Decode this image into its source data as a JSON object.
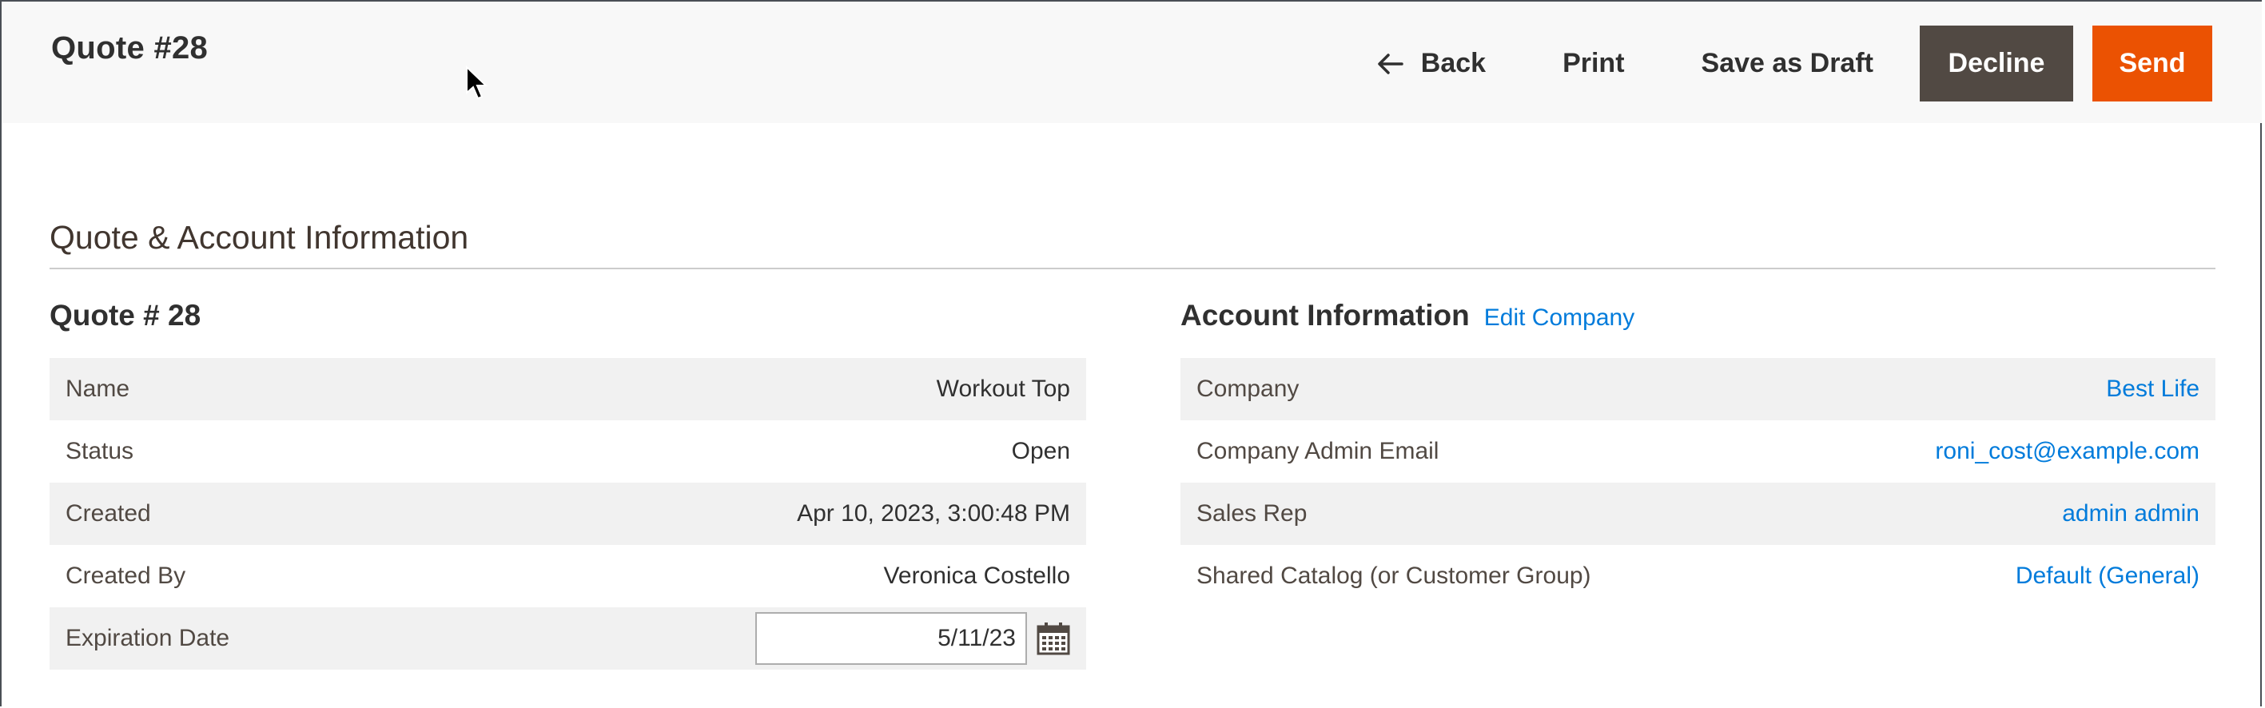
{
  "header": {
    "title": "Quote #28",
    "actions": {
      "back": "Back",
      "print": "Print",
      "save_draft": "Save as Draft",
      "decline": "Decline",
      "send": "Send"
    }
  },
  "section": {
    "title": "Quote & Account Information"
  },
  "quote": {
    "heading": "Quote # 28",
    "rows": {
      "name": {
        "label": "Name",
        "value": "Workout Top"
      },
      "status": {
        "label": "Status",
        "value": "Open"
      },
      "created": {
        "label": "Created",
        "value": "Apr 10, 2023, 3:00:48 PM"
      },
      "created_by": {
        "label": "Created By",
        "value": "Veronica Costello"
      },
      "expiration": {
        "label": "Expiration Date",
        "value": "5/11/23"
      }
    }
  },
  "account": {
    "heading": "Account Information",
    "edit_link": "Edit Company",
    "rows": {
      "company": {
        "label": "Company",
        "value": "Best Life"
      },
      "admin_email": {
        "label": "Company Admin Email",
        "value": "roni_cost@example.com"
      },
      "sales_rep": {
        "label": "Sales Rep",
        "value": "admin admin"
      },
      "shared_catalog": {
        "label": "Shared Catalog (or Customer Group)",
        "value": "Default (General)"
      }
    }
  },
  "colors": {
    "accent_send": "#eb5202",
    "decline_bg": "#514943",
    "link": "#007bdb",
    "header_bg": "#f8f8f8",
    "row_shade": "#f1f1f1"
  },
  "icons": [
    "arrow-left-icon",
    "calendar-icon",
    "mouse-pointer-icon"
  ]
}
